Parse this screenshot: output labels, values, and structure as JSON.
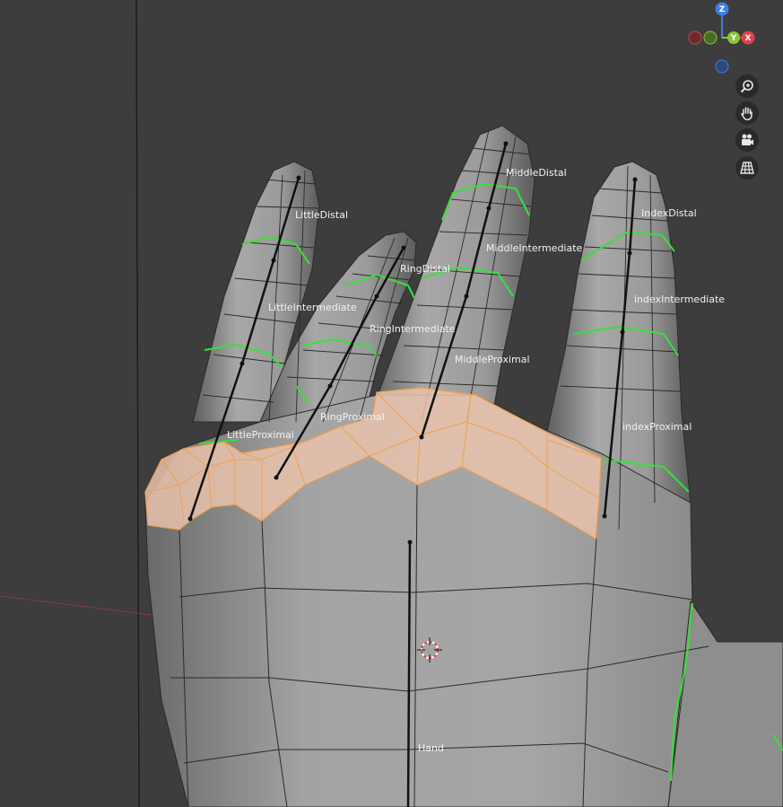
{
  "viewport": {
    "bone_labels": {
      "little_distal": "LittleDistal",
      "little_intermediate": "LittleIntermediate",
      "little_proximal": "LittleProximal",
      "ring_distal": "RingDistal",
      "ring_intermediate": "RingIntermediate",
      "ring_proximal": "RingProximal",
      "middle_distal": "MiddleDistal",
      "middle_intermediate": "MiddleIntermediate",
      "middle_proximal": "MiddleProximal",
      "index_distal": "IndexDistal",
      "index_intermediate": "indexIntermediate",
      "index_proximal": "indexProximal",
      "hand": "Hand"
    }
  },
  "gizmo": {
    "z_label": "Z",
    "y_label": "Y",
    "x_label": "X",
    "colors": {
      "x": "#e0404a",
      "y": "#8cc43a",
      "z": "#3f7fe0"
    }
  },
  "nav_controls": [
    {
      "icon": "zoom-icon"
    },
    {
      "icon": "pan-hand-icon"
    },
    {
      "icon": "camera-icon"
    },
    {
      "icon": "perspective-grid-icon"
    }
  ],
  "colors": {
    "background": "#3d3d3d",
    "mesh": "#9a9a9a",
    "selection": "#f0a050",
    "seam": "#39e039"
  }
}
